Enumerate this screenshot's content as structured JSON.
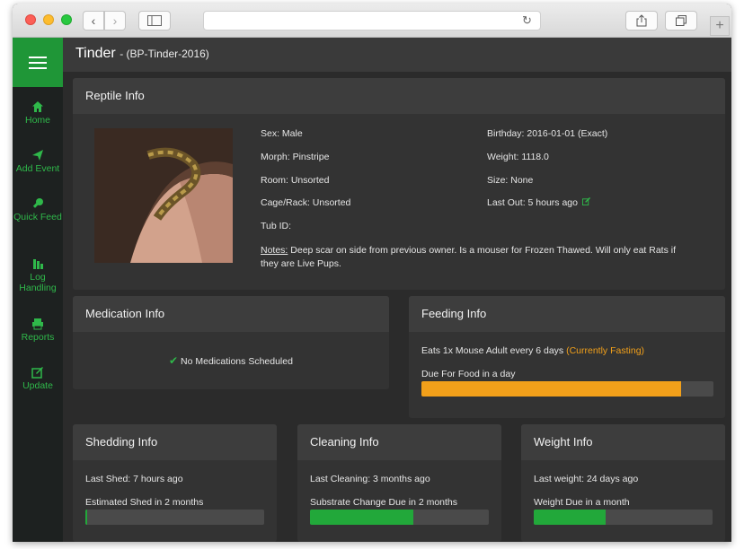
{
  "header": {
    "title": "Tinder",
    "subtitle": "- (BP-Tinder-2016)"
  },
  "sidebar": {
    "items": [
      {
        "label": "Home",
        "icon": "home-icon"
      },
      {
        "label": "Add Event",
        "icon": "send-icon"
      },
      {
        "label": "Quick Feed",
        "icon": "feed-icon"
      },
      {
        "label": "Log Handling",
        "icon": "log-icon"
      },
      {
        "label": "Reports",
        "icon": "printer-icon"
      },
      {
        "label": "Update",
        "icon": "edit-icon"
      }
    ]
  },
  "reptile_info": {
    "title": "Reptile Info",
    "sex": "Sex: Male",
    "morph": "Morph: Pinstripe",
    "room": "Room: Unsorted",
    "cage": "Cage/Rack: Unsorted",
    "tub": "Tub ID:",
    "birthday": "Birthday: 2016-01-01 (Exact)",
    "weight": "Weight: 1118.0",
    "size": "Size: None",
    "last_out": "Last Out: 5 hours ago",
    "notes_label": "Notes:",
    "notes_text": "Deep scar on side from previous owner. Is a mouser for Frozen Thawed. Will only eat Rats if they are Live Pups."
  },
  "medication_info": {
    "title": "Medication Info",
    "status": "No Medications Scheduled"
  },
  "feeding_info": {
    "title": "Feeding Info",
    "schedule": "Eats 1x Mouse Adult every 6 days",
    "fasting": "(Currently Fasting)",
    "due_label": "Due For Food in a day",
    "progress": 0.89
  },
  "shedding_info": {
    "title": "Shedding Info",
    "last": "Last Shed: 7 hours ago",
    "due_label": "Estimated Shed in 2 months",
    "progress": 0.01
  },
  "cleaning_info": {
    "title": "Cleaning Info",
    "last": "Last Cleaning: 3 months ago",
    "due_label": "Substrate Change Due in 2 months",
    "progress": 0.58
  },
  "weight_info": {
    "title": "Weight Info",
    "last": "Last weight: 24 days ago",
    "due_label": "Weight Due in a month",
    "progress": 0.4
  },
  "colors": {
    "accent_green": "#2fb84a",
    "brand_green": "#1f9637",
    "orange": "#f2a01a",
    "progress_green": "#22a83a"
  }
}
